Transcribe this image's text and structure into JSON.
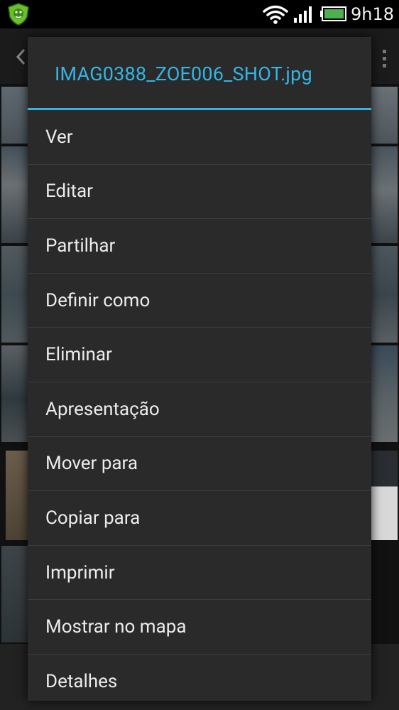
{
  "status_bar": {
    "time": "9h18",
    "app_icon": "shield-lion-icon",
    "wifi_icon": "wifi-icon",
    "signal_icon": "signal-bars-icon",
    "battery_icon": "battery-icon",
    "battery_color": "#4caf50"
  },
  "gallery": {
    "back_icon": "chevron-left-icon",
    "overflow_icon": "overflow-menu-icon"
  },
  "dialog": {
    "title": "IMAG0388_ZOE006_SHOT.jpg",
    "accent_color": "#33b5e5",
    "items": [
      {
        "label": "Ver"
      },
      {
        "label": "Editar"
      },
      {
        "label": "Partilhar"
      },
      {
        "label": "Definir como"
      },
      {
        "label": "Eliminar"
      },
      {
        "label": "Apresentação"
      },
      {
        "label": "Mover para"
      },
      {
        "label": "Copiar para"
      },
      {
        "label": "Imprimir"
      },
      {
        "label": "Mostrar no mapa"
      },
      {
        "label": "Detalhes"
      }
    ]
  }
}
